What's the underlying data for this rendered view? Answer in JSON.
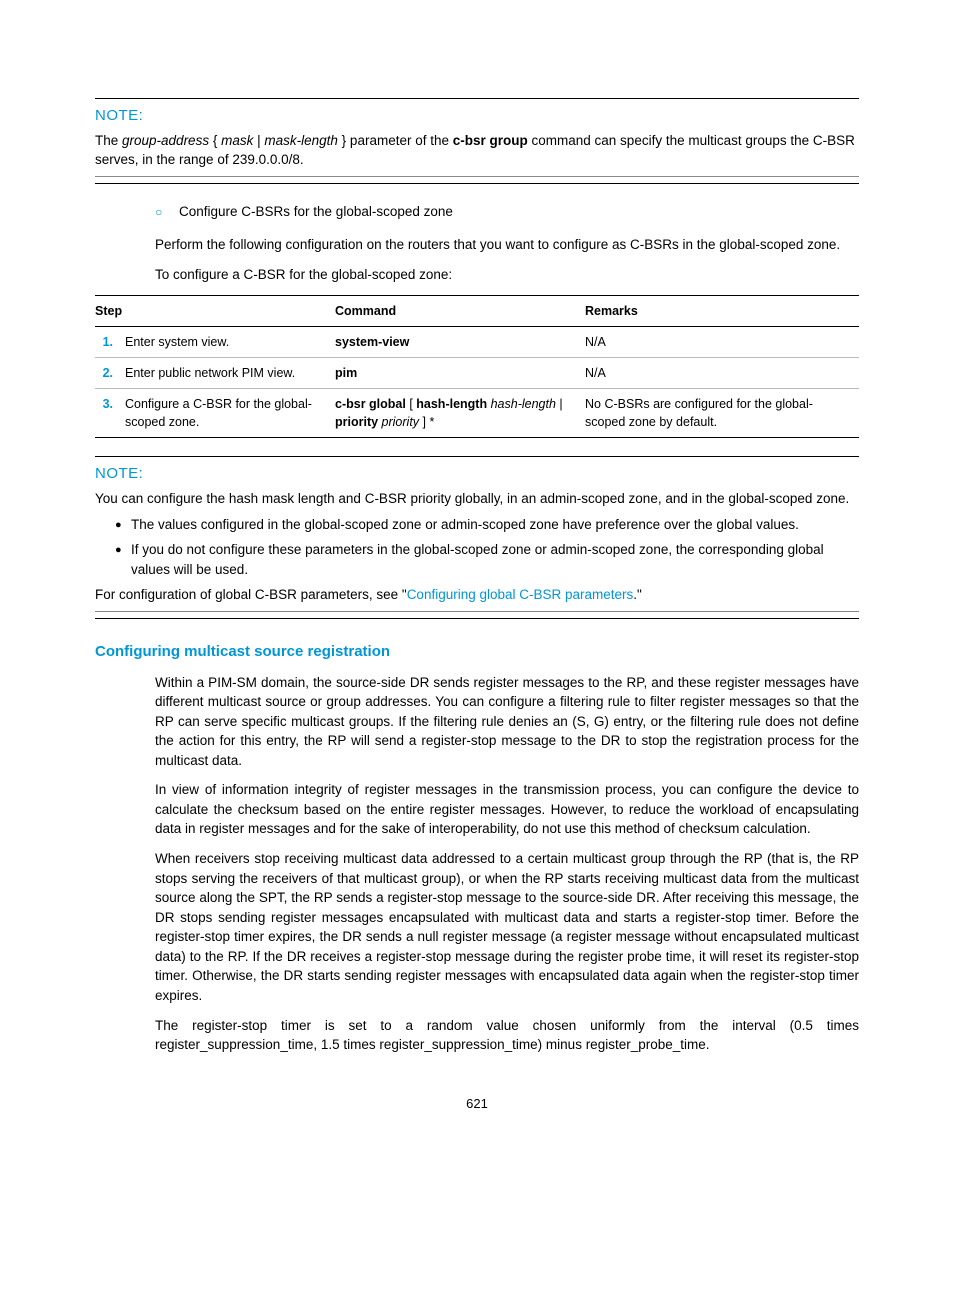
{
  "note1": {
    "title": "NOTE:",
    "text_pre": "The ",
    "text_gaddr": "group-address",
    "text_brace_open": " { ",
    "text_mask": "mask",
    "text_pipe": " | ",
    "text_masklen": "mask-length",
    "text_brace_close": " } parameter of the ",
    "text_cmd": "c-bsr group",
    "text_post": " command can specify the multicast groups the C-BSR serves, in the range of 239.0.0.0/8."
  },
  "sub": {
    "item1": "Configure C-BSRs for the global-scoped zone",
    "item1_desc": "Perform the following configuration on the routers that you want to configure as C-BSRs in the global-scoped zone.",
    "item1_caption": "To configure a C-BSR for the global-scoped zone:"
  },
  "table": {
    "hdr_step": "Step",
    "hdr_cmd": "Command",
    "hdr_rem": "Remarks",
    "rows": [
      {
        "num": "1.",
        "step": "Enter system view.",
        "cmd_bold": "system-view",
        "cmd_plain": "",
        "cmd_italic": "",
        "cmd_tail": "",
        "rem": "N/A"
      },
      {
        "num": "2.",
        "step": "Enter public network PIM view.",
        "cmd_bold": "pim",
        "cmd_plain": "",
        "cmd_italic": "",
        "cmd_tail": "",
        "rem": "N/A"
      },
      {
        "num": "3.",
        "step": "Configure a C-BSR for the global-scoped zone.",
        "cmd_bold": "c-bsr global",
        "cmd_plain": " [ ",
        "cmd_b2": "hash-length",
        "cmd_i2": " hash-length",
        "cmd_p2": " | ",
        "cmd_b3": "priority",
        "cmd_i3": " priority",
        "cmd_tail": " ] *",
        "rem": "No C-BSRs are configured for the global-scoped zone by default."
      }
    ]
  },
  "note2": {
    "title": "NOTE:",
    "intro": "You can configure the hash mask length and C-BSR priority globally, in an admin-scoped zone, and in the global-scoped zone.",
    "bullets": [
      "The values configured in the global-scoped zone or admin-scoped zone have preference over the global values.",
      "If you do not configure these parameters in the global-scoped zone or admin-scoped zone, the corresponding global values will be used."
    ],
    "footer_pre": "For configuration of global C-BSR parameters, see \"",
    "footer_link": "Configuring global C-BSR parameters",
    "footer_post": ".\""
  },
  "section": {
    "heading": "Configuring multicast source registration",
    "p1": "Within a PIM-SM domain, the source-side DR sends register messages to the RP, and these register messages have different multicast source or group addresses. You can configure a filtering rule to filter register messages so that the RP can serve specific multicast groups. If the filtering rule denies an (S, G) entry, or the filtering rule does not define the action for this entry, the RP will send a register-stop message to the DR to stop the registration process for the multicast data.",
    "p2": "In view of information integrity of register messages in the transmission process, you can configure the device to calculate the checksum based on the entire register messages. However, to reduce the workload of encapsulating data in register messages and for the sake of interoperability, do not use this method of checksum calculation.",
    "p3": "When receivers stop receiving multicast data addressed to a certain multicast group through the RP (that is, the RP stops serving the receivers of that multicast group), or when the RP starts receiving multicast data from the multicast source along the SPT, the RP sends a register-stop message to the source-side DR. After receiving this message, the DR stops sending register messages encapsulated with multicast data and starts a register-stop timer. Before the register-stop timer expires, the DR sends a null register message (a register message without encapsulated multicast data) to the RP. If the DR receives a register-stop message during the register probe time, it will reset its register-stop timer. Otherwise, the DR starts sending register messages with encapsulated data again when the register-stop timer expires.",
    "p4": "The register-stop timer is set to a random value chosen uniformly from the interval (0.5 times register_suppression_time, 1.5 times register_suppression_time) minus register_probe_time."
  },
  "pagenum": "621"
}
